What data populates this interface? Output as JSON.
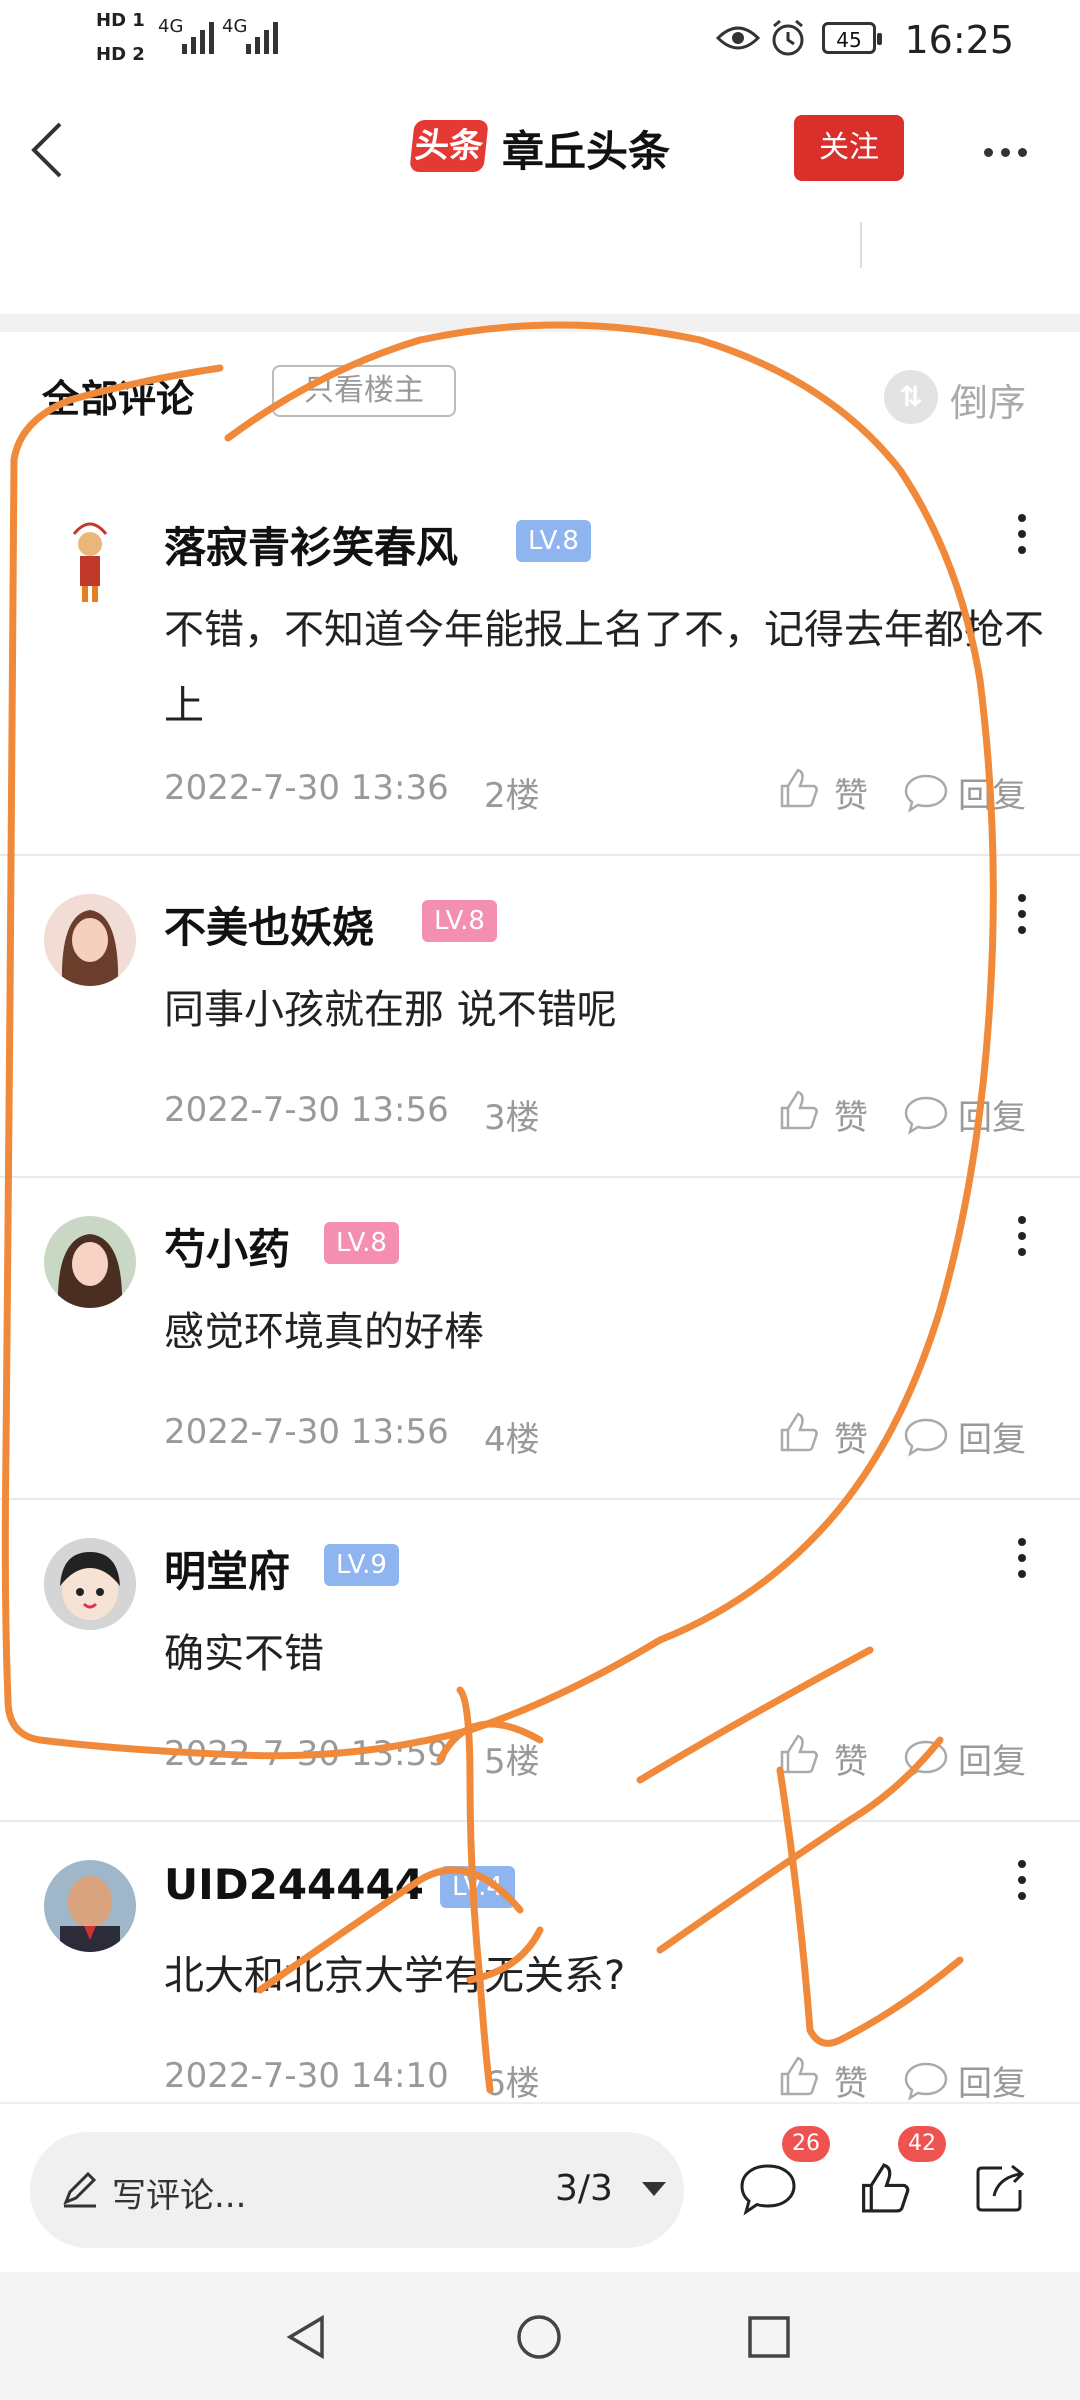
{
  "status_bar": {
    "time": "16:25",
    "battery": "45",
    "hd1": "HD 1",
    "hd2": "HD 2",
    "network1": "4G",
    "network2": "4G"
  },
  "header": {
    "logo_text": "头条",
    "title": "章丘头条",
    "follow_label": "关注"
  },
  "comments_section": {
    "title": "全部评论",
    "only_op_label": "只看楼主",
    "sort_label": "倒序"
  },
  "comments": [
    {
      "name": "落寂青衫笑春风",
      "level": "LV.8",
      "level_color": "#8fb5f0",
      "text": "不错，不知道今年能报上名了不，记得去年都抢不上",
      "date": "2022-7-30 13:36",
      "floor": "2楼",
      "like_label": "赞",
      "reply_label": "回复"
    },
    {
      "name": "不美也妖娆",
      "level": "LV.8",
      "level_color": "#f48fb1",
      "text": "同事小孩就在那 说不错呢",
      "date": "2022-7-30 13:56",
      "floor": "3楼",
      "like_label": "赞",
      "reply_label": "回复"
    },
    {
      "name": "芍小药",
      "level": "LV.8",
      "level_color": "#f48fb1",
      "text": "感觉环境真的好棒",
      "date": "2022-7-30 13:56",
      "floor": "4楼",
      "like_label": "赞",
      "reply_label": "回复"
    },
    {
      "name": "明堂府",
      "level": "LV.9",
      "level_color": "#8fb5f0",
      "text": "确实不错",
      "date": "2022-7-30 13:59",
      "floor": "5楼",
      "like_label": "赞",
      "reply_label": "回复"
    },
    {
      "name": "UID244444",
      "level": "LV.4",
      "level_color": "#8fb5f0",
      "text": "北大和北京大学有无关系?",
      "date": "2022-7-30 14:10",
      "floor": "6楼",
      "like_label": "赞",
      "reply_label": "回复"
    }
  ],
  "bottom_bar": {
    "write_placeholder": "写评论...",
    "page_indicator": "3/3",
    "comment_count": "26",
    "like_count": "42"
  },
  "colors": {
    "accent_red": "#d9302c",
    "annotation_orange": "#f08a3a"
  }
}
